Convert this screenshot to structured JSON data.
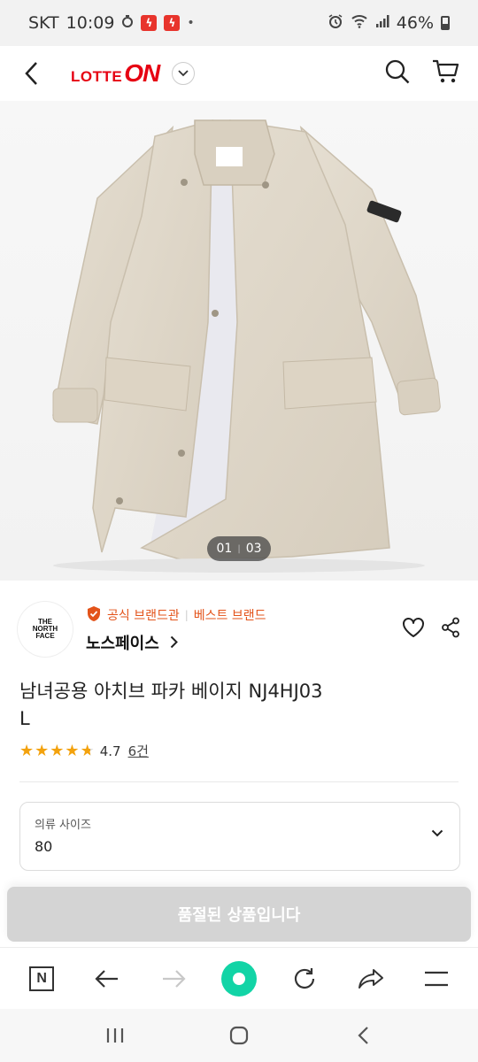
{
  "status_bar": {
    "carrier": "SKT",
    "time": "10:09",
    "dot": "•",
    "battery_percent": "46%"
  },
  "header": {
    "logo_lotte": "LOTTE",
    "logo_on": "ON",
    "brand_color": "#e60012"
  },
  "gallery": {
    "current": "01",
    "total": "03"
  },
  "brand": {
    "logo_text_1": "THE",
    "logo_text_2": "NORTH",
    "logo_text_3": "FACE",
    "badge_official": "공식 브랜드관",
    "badge_best": "베스트 브랜드",
    "name": "노스페이스",
    "badge_color": "#e3531a"
  },
  "product": {
    "title_line1": "남녀공용 아치브 파카 베이지 NJ4HJ03",
    "title_line2": "L",
    "rating": "4.7",
    "rating_stars": 4.7,
    "review_count": "6건"
  },
  "size_select": {
    "label": "의류 사이즈",
    "value": "80"
  },
  "buy_button": {
    "label": "품절된 상품입니다"
  },
  "browser_bar": {
    "home_color": "#12d4a6"
  }
}
